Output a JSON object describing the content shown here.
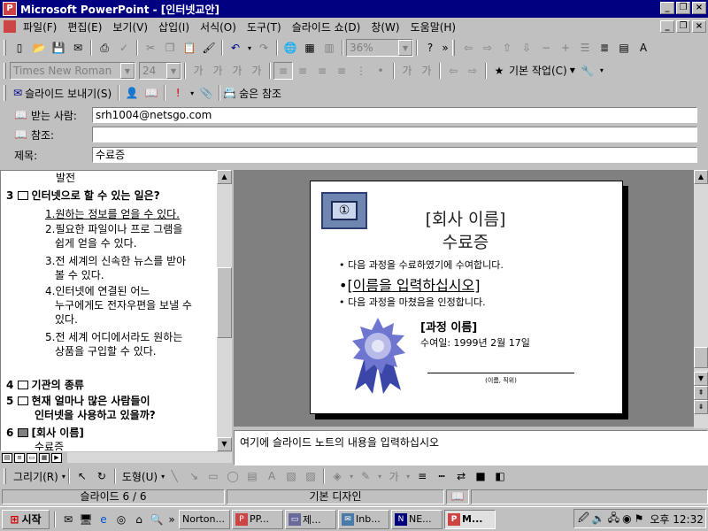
{
  "window": {
    "title": "Microsoft PowerPoint - [인터넷교안]",
    "app_icon": "P"
  },
  "menu": [
    "파일(F)",
    "편집(E)",
    "보기(V)",
    "삽입(I)",
    "서식(O)",
    "도구(T)",
    "슬라이드 쇼(D)",
    "창(W)",
    "도움말(H)"
  ],
  "standard_toolbar": {
    "zoom": "36%"
  },
  "format_toolbar": {
    "font": "Times New Roman",
    "size": "24",
    "common_tasks": "기본 작업(C)"
  },
  "mail": {
    "send_slide": "슬라이드 보내기(S)",
    "bcc": "숨은 참조",
    "to_label": "받는 사람:",
    "to_value": "srh1004@netsgo.com",
    "cc_label": "참조:",
    "cc_value": "",
    "subject_label": "제목:",
    "subject_value": "수료증"
  },
  "outline": {
    "top_fragment": "발전",
    "slide3": {
      "num": "3",
      "title": "인터넷으로 할 수 있는 일은?",
      "items": [
        [
          "1.원하는 정보를 얻을 수 있다."
        ],
        [
          "2.필요한 파일이나 프로 그램을",
          "쉽게 얻을 수 있다."
        ],
        [
          "3.전 세계의 신속한 뉴스를 받아",
          "볼 수 있다."
        ],
        [
          "4.인터넷에 연결된 어느",
          "누구에게도 전자우편을 보낼 수",
          "있다."
        ],
        [
          "5.전 세계 어디에서라도 원하는",
          "상품을 구입할 수 있다."
        ]
      ]
    },
    "slide4": {
      "num": "4",
      "title": "기관의 종류"
    },
    "slide5": {
      "num": "5",
      "title1": "현재 얼마나 많은 사람들이",
      "title2": "인터넷을 사용하고 있을까?"
    },
    "slide6": {
      "num": "6",
      "title": "[회사 이름]",
      "sub": "수료증"
    }
  },
  "slide": {
    "badge": "①",
    "company": "[회사 이름]",
    "title": "수료증",
    "bullet1": "• 다음 과정을 수료하였기에 수여합니다.",
    "name_placeholder": "[이름을 입력하십시오]",
    "bullet2": "• 다음 과정을 마쳤음을 인정합니다.",
    "course_name": "[과정 이름]",
    "award_date": "수여일: 1999년 2월 17일",
    "signature_caption": "(이름, 직위)"
  },
  "notes": {
    "placeholder": "여기에 슬라이드 노트의 내용을 입력하십시오"
  },
  "draw_toolbar": {
    "draw": "그리기(R)",
    "autoshapes": "도형(U)"
  },
  "status": {
    "slide_info": "슬라이드 6 / 6",
    "design": "기본 디자인"
  },
  "taskbar": {
    "start": "시작",
    "tasks": [
      "Norton...",
      "PP...",
      "제...",
      "Inb...",
      "NE...",
      "M..."
    ],
    "clock": "오후 12:32"
  },
  "colors": {
    "titlebar": "#000080",
    "face": "#c0c0c0",
    "slide_bg": "#808080",
    "ribbon": "#5a5ab8"
  }
}
